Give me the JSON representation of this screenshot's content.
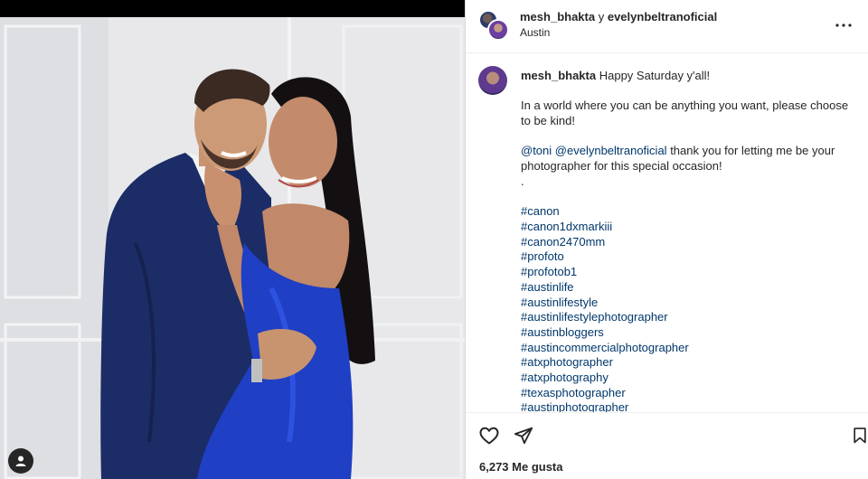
{
  "post": {
    "author": "mesh_bhakta",
    "conjunction": "y",
    "collaborator": "evelynbeltranoficial",
    "location": "Austin"
  },
  "caption": {
    "username": "mesh_bhakta",
    "line1": "Happy Saturday y'all!",
    "line2": "In a world where you can be anything you want, please choose to be kind!",
    "mention1": "@toni",
    "mention2": "@evelynbeltranoficial",
    "line3_rest": "thank you for letting me be your photographer for this special occasion!",
    "dot": ".",
    "hashtags": [
      "#canon",
      "#canon1dxmarkiii",
      "#canon2470mm",
      "#profoto",
      "#profotob1",
      "#austinlife",
      "#austinlifestyle",
      "#austinlifestylephotographer",
      "#austinbloggers",
      "#austincommercialphotographer",
      "#atxphotographer",
      "#atxphotography",
      "#texasphotographer",
      "#austinphotographer"
    ]
  },
  "likes": {
    "text": "6,273 Me gusta"
  },
  "icons": {
    "more": "more-horizontal-icon",
    "like": "heart-icon",
    "share": "paper-plane-icon",
    "save": "bookmark-icon",
    "tags": "user-tag-icon"
  },
  "colors": {
    "link": "#00376b",
    "dress": "#1f3fc4",
    "suit": "#1c2c66"
  }
}
